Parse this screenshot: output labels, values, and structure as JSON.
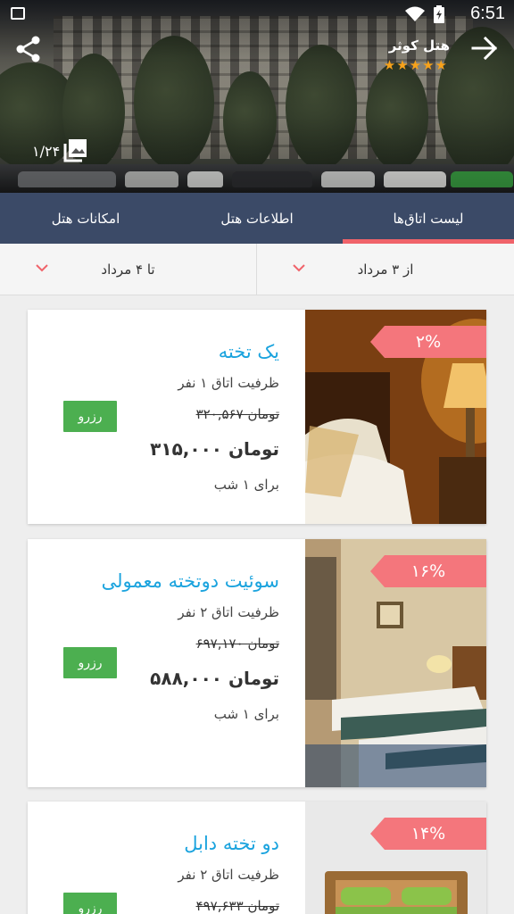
{
  "status_bar": {
    "time": "6:51"
  },
  "hotel": {
    "name": "هتل کوثر",
    "stars": "★★★★★"
  },
  "gallery": {
    "count": "۱/۲۴"
  },
  "tabs": [
    {
      "label": "لیست اتاق‌ها",
      "active": true
    },
    {
      "label": "اطلاعات هتل",
      "active": false
    },
    {
      "label": "امکانات هتل",
      "active": false
    }
  ],
  "dates": {
    "from": "از ۳ مرداد",
    "to": "تا ۴ مرداد"
  },
  "rooms": [
    {
      "title": "یک تخته",
      "capacity": "ظرفیت اتاق ۱ نفر",
      "old_price": "۳۲۰,۵۶۷ تومان",
      "price": "۳۱۵,۰۰۰ تومان",
      "per": "برای ۱ شب",
      "discount": "۲%",
      "reserve": "رزرو"
    },
    {
      "title": "سوئیت دوتخته معمولی",
      "capacity": "ظرفیت اتاق ۲ نفر",
      "old_price": "۶۹۷,۱۷۰ تومان",
      "price": "۵۸۸,۰۰۰ تومان",
      "per": "برای ۱ شب",
      "discount": "۱۶%",
      "reserve": "رزرو"
    },
    {
      "title": "دو تخته دابل",
      "capacity": "ظرفیت اتاق ۲ نفر",
      "old_price": "۴۹۷,۶۳۳ تومان",
      "discount": "۱۴%",
      "reserve": "رزرو"
    }
  ],
  "colors": {
    "tab_bar": "#3b4a67",
    "tab_indicator": "#f0636a",
    "room_title": "#1aa3de",
    "reserve_button": "#4caf50",
    "discount_tag": "#f4767c",
    "stars": "#f7a21b"
  },
  "icons": [
    "back-arrow-icon",
    "share-icon",
    "gallery-icon",
    "chevron-down-icon",
    "wifi-icon",
    "battery-icon",
    "image-notification-icon"
  ]
}
